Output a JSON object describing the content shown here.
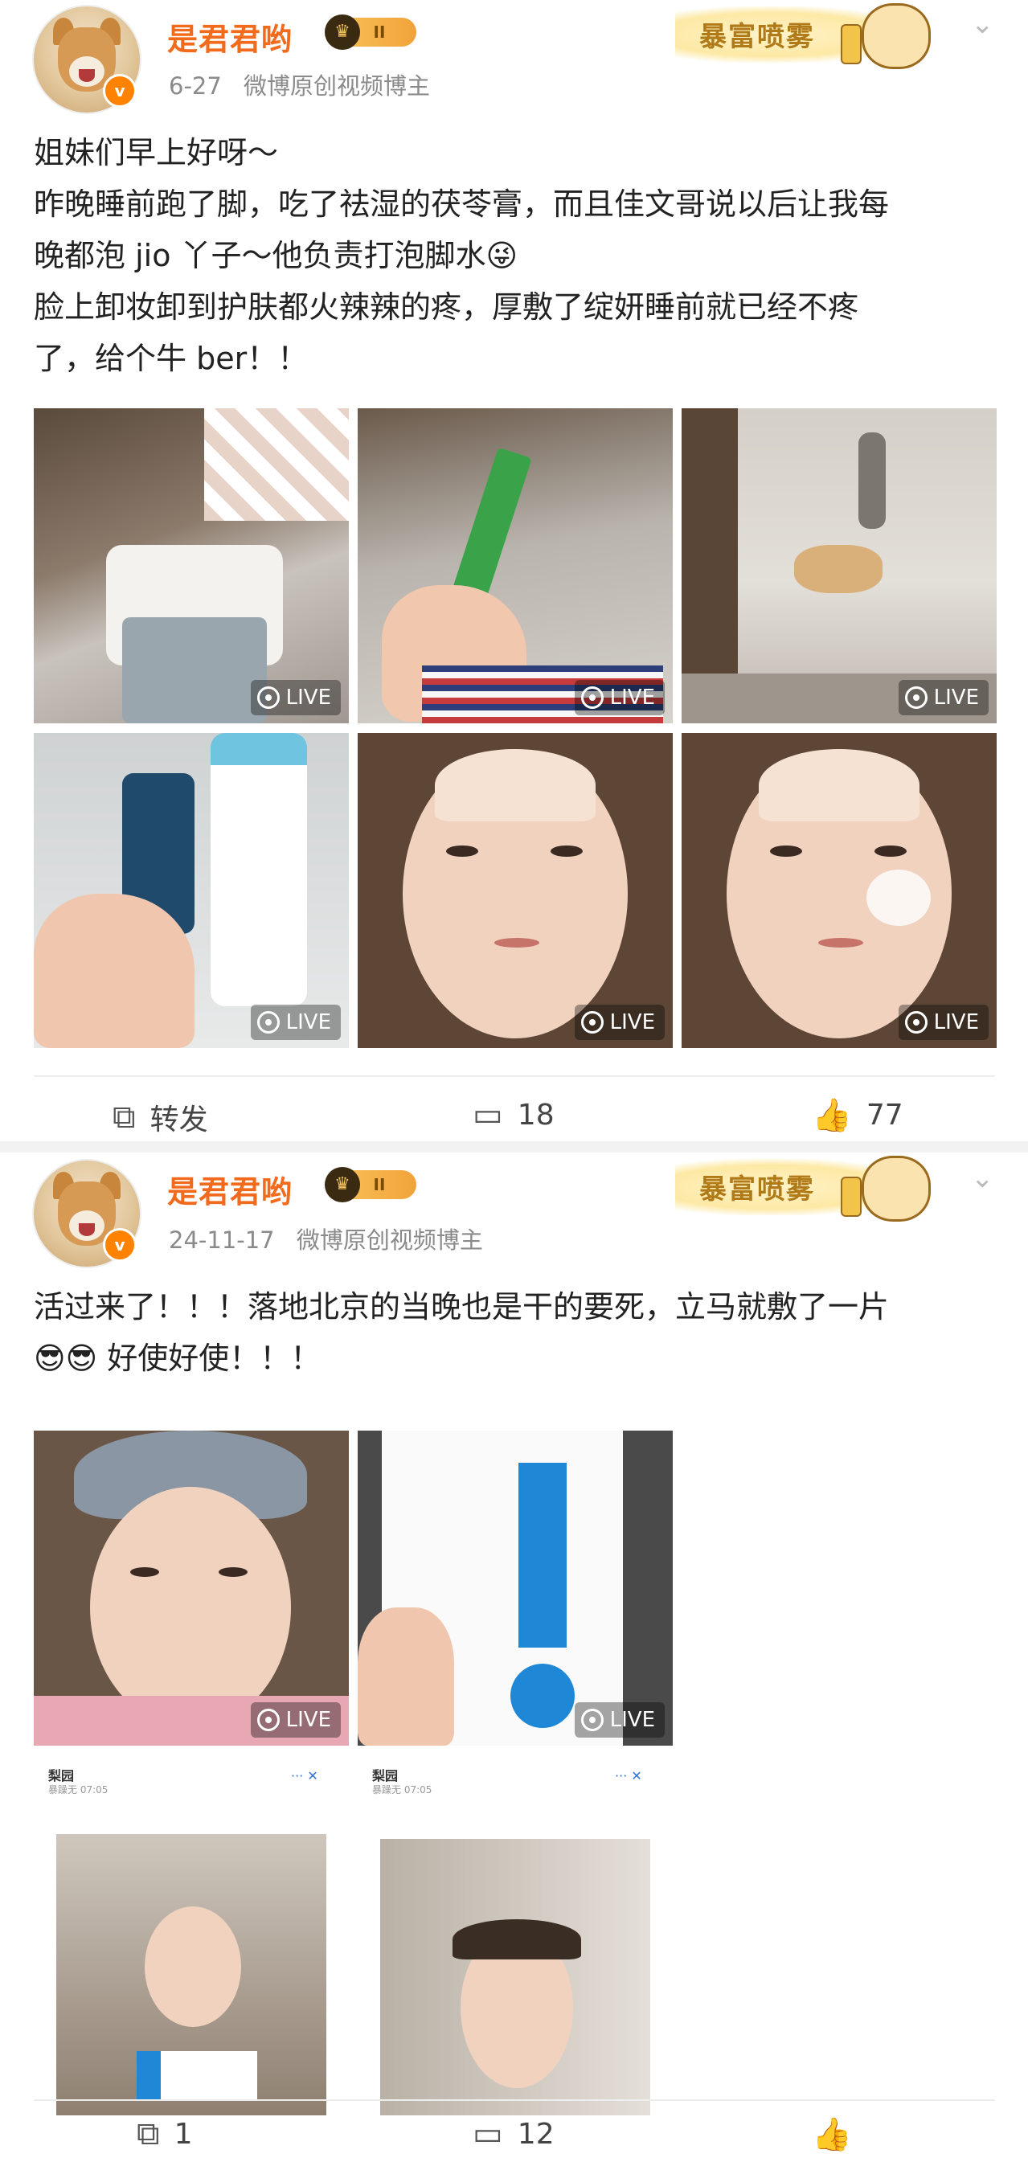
{
  "posts": [
    {
      "username": "是君君哟",
      "vip_label": "II",
      "date": "6-27",
      "source": "微博原创视频博主",
      "decoration_text": "暴富喷雾",
      "text_lines": [
        "姐妹们早上好呀～",
        "昨晚睡前跑了脚，吃了祛湿的茯苓膏，而且佳文哥说以后让我每",
        "晚都泡 jio 丫子～他负责打泡脚水😜",
        "脸上卸妆卸到护肤都火辣辣的疼，厚敷了绽妍睡前就已经不疼",
        "了，给个牛 ber！！"
      ],
      "live_label": "LIVE",
      "repost_label": "转发",
      "comment_count": "18",
      "like_count": "77"
    },
    {
      "username": "是君君哟",
      "vip_label": "II",
      "date": "24-11-17",
      "source": "微博原创视频博主",
      "decoration_text": "暴富喷雾",
      "text_lines": [
        "活过来了！！！落地北京的当晚也是干的要死，立马就敷了一片",
        "😎😎 好使好使！！！"
      ],
      "live_label": "LIVE",
      "chat_name": "梨园",
      "chat_sub": "暴躁无 07:05",
      "chat_sub2": "暴躁无 07:05",
      "repost_count": "1",
      "comment_count": "12",
      "like_count": ""
    }
  ],
  "icons": {
    "verify": "v",
    "repost": "repost-icon",
    "comment": "comment-icon",
    "like": "like-icon",
    "chevron": "chevron-down-icon"
  },
  "colors": {
    "username": "#f26a1b",
    "meta": "#8a8a8a",
    "verify": "#ff8200"
  }
}
